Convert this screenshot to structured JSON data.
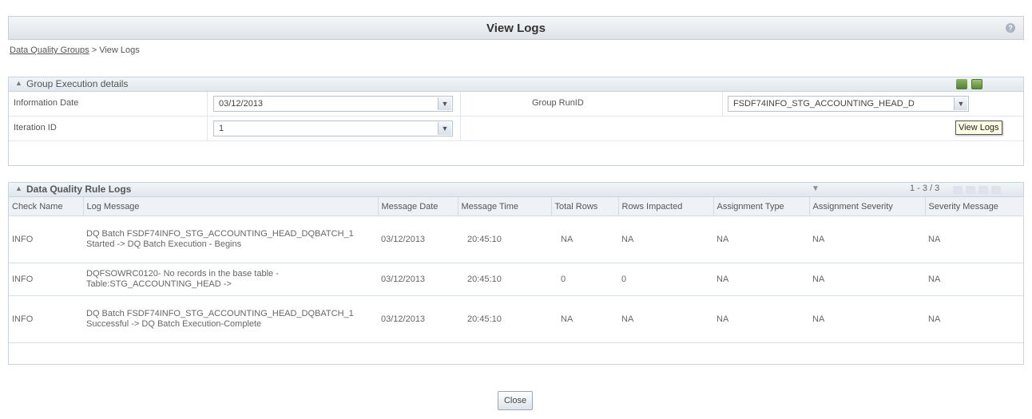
{
  "window": {
    "title": "View Logs",
    "help_icon": "help-icon"
  },
  "breadcrumb": {
    "link": "Data Quality Groups",
    "separator": ">",
    "current": "View Logs"
  },
  "group_execution": {
    "title": "Group Execution details",
    "information_date_label": "Information Date",
    "information_date_value": "03/12/2013",
    "group_runid_label": "Group RunID",
    "group_runid_value": "FSDF74INFO_STG_ACCOUNTING_HEAD_D",
    "iteration_id_label": "Iteration ID",
    "iteration_id_value": "1",
    "toolbar_icons": [
      "view-logs-icon",
      "export-icon"
    ],
    "tooltip": "View Logs"
  },
  "rule_logs": {
    "title": "Data Quality Rule Logs",
    "pager": "1 - 3 / 3",
    "columns": [
      "Check Name",
      "Log Message",
      "Message Date",
      "Message Time",
      "Total Rows",
      "Rows Impacted",
      "Assignment Type",
      "Assignment Severity",
      "Severity Message"
    ],
    "rows": [
      {
        "check_name": "INFO",
        "log_message": "DQ Batch FSDF74INFO_STG_ACCOUNTING_HEAD_DQBATCH_1 Started -> DQ Batch Execution - Begins",
        "message_date": "03/12/2013",
        "message_time": "20:45:10",
        "total_rows": "NA",
        "rows_impacted": "NA",
        "assignment_type": "NA",
        "assignment_severity": "NA",
        "severity_message": "NA"
      },
      {
        "check_name": "INFO",
        "log_message": "DQFSOWRC0120- No records in the base table - Table:STG_ACCOUNTING_HEAD ->",
        "message_date": "03/12/2013",
        "message_time": "20:45:10",
        "total_rows": "0",
        "rows_impacted": "0",
        "assignment_type": "NA",
        "assignment_severity": "NA",
        "severity_message": "NA"
      },
      {
        "check_name": "INFO",
        "log_message": "DQ Batch FSDF74INFO_STG_ACCOUNTING_HEAD_DQBATCH_1 Successful -> DQ Batch Execution-Complete",
        "message_date": "03/12/2013",
        "message_time": "20:45:10",
        "total_rows": "NA",
        "rows_impacted": "NA",
        "assignment_type": "NA",
        "assignment_severity": "NA",
        "severity_message": "NA"
      }
    ]
  },
  "footer": {
    "close_label": "Close"
  },
  "colors": {
    "accent": "#5a78a0",
    "header_bg": "#e1e7ee",
    "border": "#c9d3df"
  }
}
